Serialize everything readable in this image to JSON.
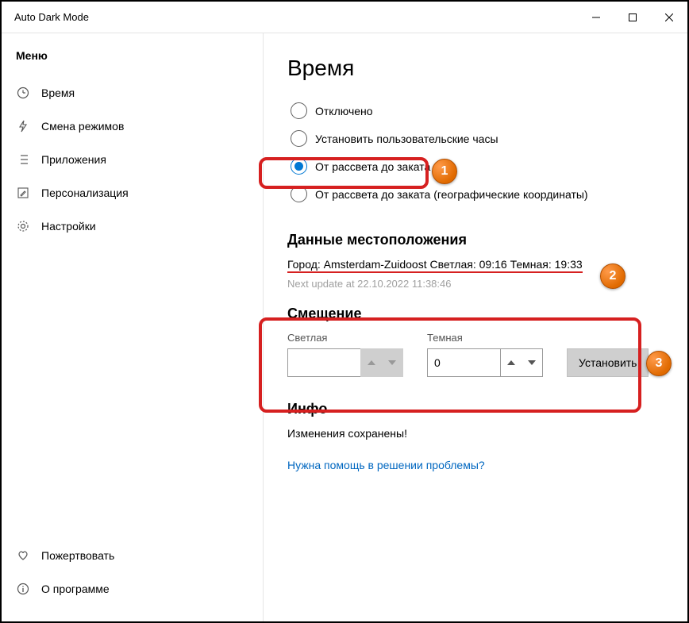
{
  "window": {
    "title": "Auto Dark Mode"
  },
  "sidebar": {
    "title": "Меню",
    "items": {
      "time": {
        "label": "Время"
      },
      "switch": {
        "label": "Смена режимов"
      },
      "apps": {
        "label": "Приложения"
      },
      "personal": {
        "label": "Персонализация"
      },
      "settings": {
        "label": "Настройки"
      },
      "donate": {
        "label": "Пожертвовать"
      },
      "about": {
        "label": "О программе"
      }
    }
  },
  "page": {
    "title": "Время",
    "radios": {
      "disabled": {
        "label": "Отключено"
      },
      "custom": {
        "label": "Установить пользовательские часы"
      },
      "sunset": {
        "label": "От рассвета до заката",
        "selected": true
      },
      "sunset_geo": {
        "label": "От рассвета до заката (географические координаты)"
      }
    },
    "location": {
      "heading": "Данные местоположения",
      "city_label": "Город:",
      "city_value": "Amsterdam-Zuidoost",
      "light_label": "Светлая:",
      "light_value": "09:16",
      "dark_label": "Темная:",
      "dark_value": "19:33",
      "next_update": "Next update at 22.10.2022 11:38:46"
    },
    "offset": {
      "heading": "Смещение",
      "light_label": "Светлая",
      "light_value": "",
      "dark_label": "Темная",
      "dark_value": "0",
      "set_button": "Установить"
    },
    "info": {
      "heading": "Инфо",
      "message": "Изменения сохранены!",
      "help_link": "Нужна помощь в решении проблемы?"
    }
  },
  "steps": {
    "s1": "1",
    "s2": "2",
    "s3": "3"
  }
}
